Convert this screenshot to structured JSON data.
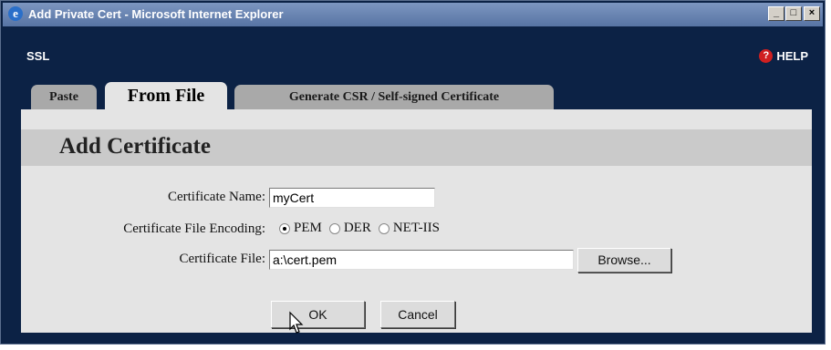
{
  "window": {
    "title": "Add Private Cert - Microsoft Internet Explorer",
    "controls": {
      "minimize": "_",
      "maximize": "□",
      "close": "×"
    }
  },
  "header": {
    "section": "SSL",
    "help_label": "HELP",
    "help_icon": "question-circle-icon"
  },
  "tabs": [
    {
      "label": "Paste",
      "active": false
    },
    {
      "label": "From File",
      "active": true
    },
    {
      "label": "Generate CSR / Self-signed Certificate",
      "active": false
    }
  ],
  "panel": {
    "title": "Add Certificate",
    "fields": {
      "cert_name": {
        "label": "Certificate Name:",
        "value": "myCert"
      },
      "encoding": {
        "label": "Certificate File Encoding:",
        "options": [
          "PEM",
          "DER",
          "NET-IIS"
        ],
        "selected": "PEM"
      },
      "cert_file": {
        "label": "Certificate File:",
        "value": "a:\\cert.pem",
        "browse_label": "Browse..."
      }
    },
    "buttons": {
      "ok": "OK",
      "cancel": "Cancel"
    }
  },
  "colors": {
    "background": "#0c2245",
    "panel": "#e4e4e4",
    "panel_header": "#cacaca",
    "tab_inactive": "#a9a9a9"
  }
}
